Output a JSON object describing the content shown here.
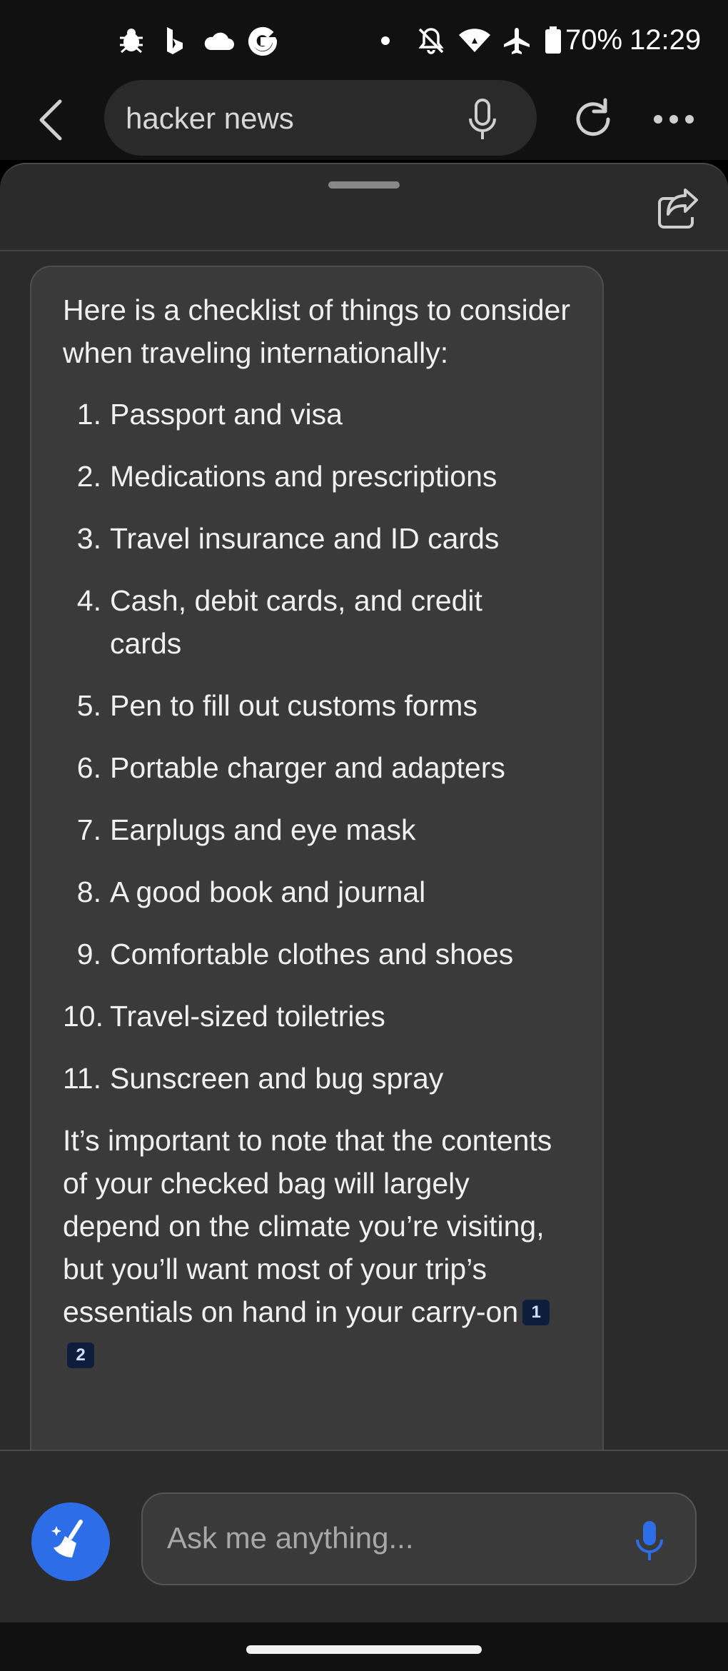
{
  "status_bar": {
    "battery": "70%",
    "time": "12:29",
    "icons": [
      "bug-icon",
      "bing-icon",
      "cloud-icon",
      "google-icon",
      "dot-icon",
      "mute-icon",
      "wifi-icon",
      "airplane-icon",
      "battery-icon"
    ]
  },
  "browser": {
    "url_text": "hacker news",
    "icons": [
      "back-arrow-icon",
      "mic-icon",
      "reload-icon",
      "more-icon"
    ]
  },
  "chat": {
    "intro": "Here is a checklist of things to consider when traveling internationally:",
    "items": [
      {
        "num": "1.",
        "text": "Passport and visa"
      },
      {
        "num": "2.",
        "text": "Medications and prescriptions"
      },
      {
        "num": "3.",
        "text": "Travel insurance and ID cards"
      },
      {
        "num": "4.",
        "text": "Cash, debit cards, and credit cards"
      },
      {
        "num": "5.",
        "text": "Pen to fill out customs forms"
      },
      {
        "num": "6.",
        "text": "Portable charger and adapters"
      },
      {
        "num": "7.",
        "text": "Earplugs and eye mask"
      },
      {
        "num": "8.",
        "text": "A good book and journal"
      },
      {
        "num": "9.",
        "text": "Comfortable clothes and shoes"
      },
      {
        "num": "10.",
        "text": "Travel-sized toiletries"
      },
      {
        "num": "11.",
        "text": "Sunscreen and bug spray"
      }
    ],
    "outro": "It’s important to note that the contents of your checked bag will largely depend on the climate you’re visiting, but you’ll want most of your trip’s essentials on hand in your carry-on",
    "citations": [
      "1",
      "2"
    ]
  },
  "input": {
    "placeholder": "Ask me anything..."
  },
  "colors": {
    "accent": "#2d6ee8",
    "panel_bg": "#2b2b2b",
    "bubble_bg": "#3a3a3a"
  }
}
